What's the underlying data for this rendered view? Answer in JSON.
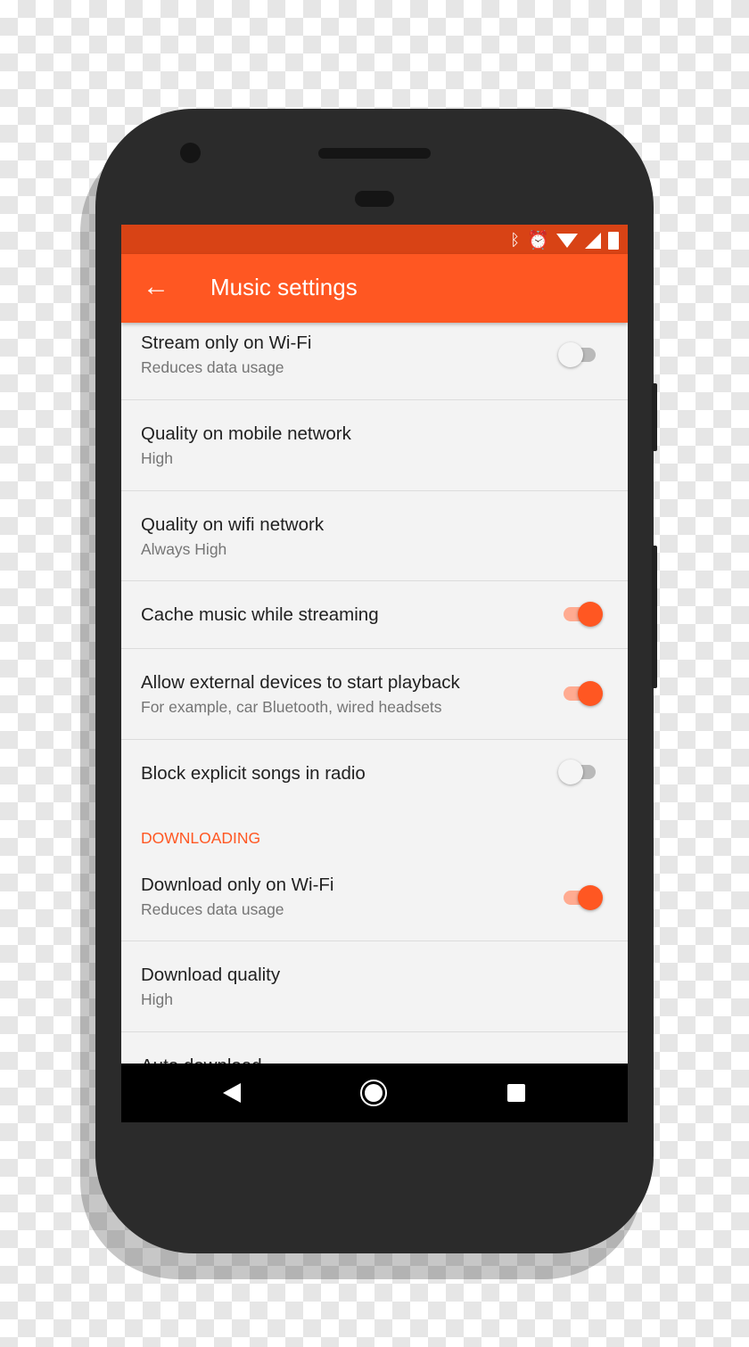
{
  "app_bar": {
    "title": "Music settings",
    "back_icon": "arrow-left-icon"
  },
  "status_bar": {
    "icons": [
      "bluetooth-icon",
      "alarm-icon",
      "wifi-icon",
      "signal-icon",
      "battery-icon"
    ]
  },
  "accent_color": "#ff5722",
  "settings": [
    {
      "title": "Stream only on Wi-Fi",
      "subtitle": "Reduces data usage",
      "toggle": false
    },
    {
      "title": "Quality on mobile network",
      "subtitle": "High"
    },
    {
      "title": "Quality on wifi network",
      "subtitle": "Always High"
    },
    {
      "title": "Cache music while streaming",
      "toggle": true
    },
    {
      "title": "Allow external devices to start playback",
      "subtitle": "For example, car Bluetooth, wired headsets",
      "toggle": true
    },
    {
      "title": "Block explicit songs in radio",
      "toggle": false
    }
  ],
  "downloading": {
    "header": "DOWNLOADING",
    "items": [
      {
        "title": "Download only on Wi-Fi",
        "subtitle": "Reduces data usage",
        "toggle": true
      },
      {
        "title": "Download quality",
        "subtitle": "High"
      },
      {
        "title": "Auto download"
      }
    ]
  },
  "nav_bar": {
    "icons": [
      "back-icon",
      "home-icon",
      "recents-icon"
    ]
  }
}
